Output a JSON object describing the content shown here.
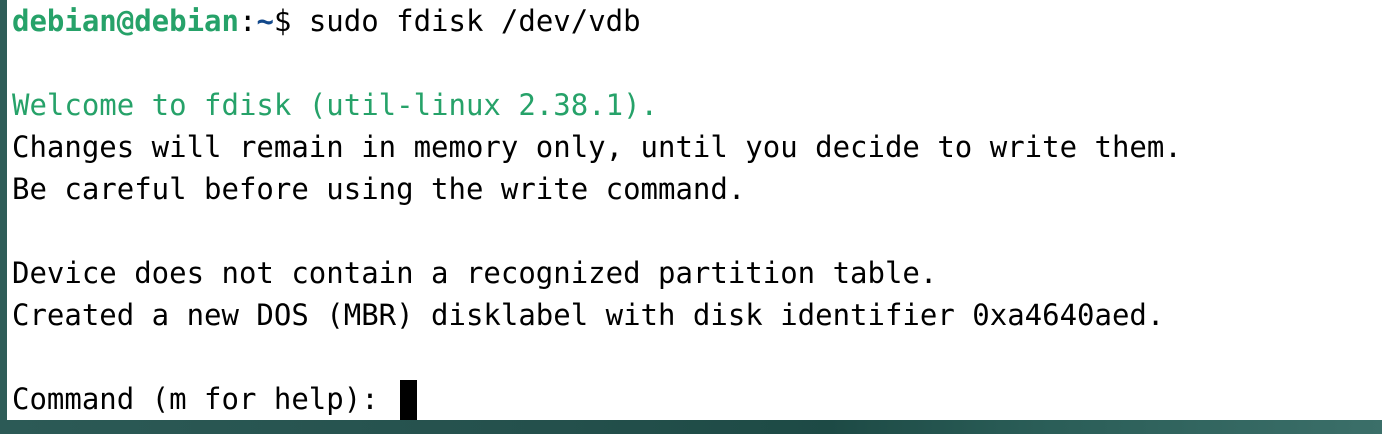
{
  "terminal": {
    "prompt": {
      "user_host": "debian@debian",
      "separator": ":",
      "path": "~",
      "symbol": "$ ",
      "command": "sudo fdisk /dev/vdb"
    },
    "output": {
      "welcome": "Welcome to fdisk (util-linux 2.38.1).",
      "changes_note": "Changes will remain in memory only, until you decide to write them.",
      "careful_note": "Be careful before using the write command.",
      "no_table": "Device does not contain a recognized partition table.",
      "created_label": "Created a new DOS (MBR) disklabel with disk identifier 0xa4640aed."
    },
    "input_prompt": "Command (m for help): "
  },
  "colors": {
    "prompt_user": "#26a269",
    "prompt_path": "#12488b",
    "welcome_text": "#26a269",
    "background": "#ffffff",
    "foreground": "#000000"
  }
}
